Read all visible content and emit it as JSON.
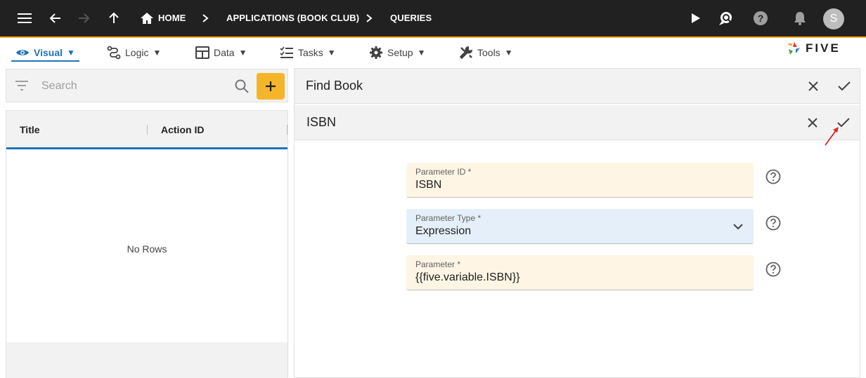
{
  "topbar": {
    "breadcrumbs": [
      "HOME",
      "APPLICATIONS (BOOK CLUB)",
      "QUERIES"
    ],
    "avatar_initial": "S",
    "icons": [
      "menu-icon",
      "back-arrow-icon",
      "forward-arrow-icon",
      "up-arrow-icon",
      "home-icon",
      "chevron-right-icon",
      "play-icon",
      "search-chat-icon",
      "help-icon",
      "bell-icon"
    ]
  },
  "menubar": {
    "items": [
      "Visual",
      "Logic",
      "Data",
      "Tasks",
      "Setup",
      "Tools"
    ],
    "active": "Visual",
    "dropdown_glyph": "▼",
    "logo_text": "FIVE"
  },
  "left": {
    "search_placeholder": "Search",
    "columns": [
      "Title",
      "Action ID"
    ],
    "empty_text": "No Rows"
  },
  "right": {
    "outer_title": "Find Book",
    "inner_title": "ISBN",
    "fields": [
      {
        "label": "Parameter ID *",
        "value": "ISBN",
        "style": "yellow"
      },
      {
        "label": "Parameter Type *",
        "value": "Expression",
        "style": "blue",
        "dropdown": true
      },
      {
        "label": "Parameter *",
        "value": "{{five.variable.ISBN}}",
        "style": "yellow"
      }
    ]
  },
  "colors": {
    "topbar": "#212121",
    "accent_orange": "#f5a623",
    "accent_blue": "#1e73be",
    "add_button": "#f5b52b",
    "field_yellow": "#fef5e4",
    "field_blue": "#e5effa",
    "annotation_red": "#e02020"
  }
}
